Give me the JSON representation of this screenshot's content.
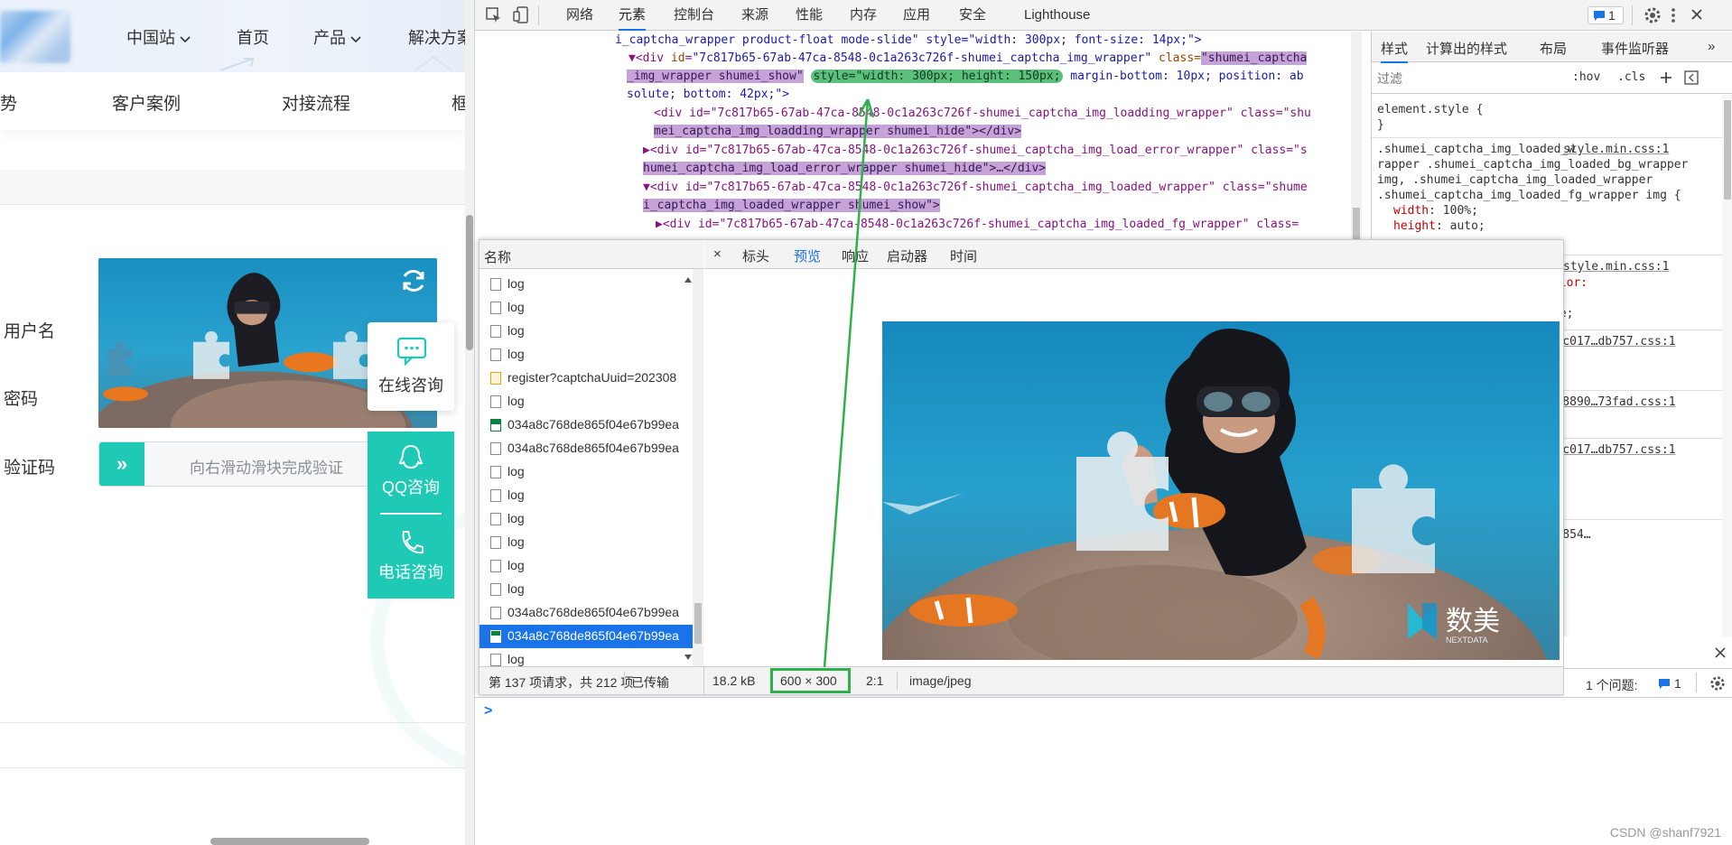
{
  "site": {
    "topnav": [
      {
        "label": "中国站",
        "has_chevron": true
      },
      {
        "label": "首页",
        "has_chevron": false
      },
      {
        "label": "产品",
        "has_chevron": true
      },
      {
        "label": "解决方案",
        "has_chevron": false
      }
    ],
    "subnav": [
      "势",
      "客户案例",
      "对接流程",
      "框"
    ],
    "form": {
      "username_label": "用户名",
      "password_label": "密码",
      "captcha_label": "验证码",
      "slider_text": "向右滑动滑块完成验证",
      "slider_arrow": "»"
    },
    "float": {
      "online": "在线咨询",
      "qq": "QQ咨询",
      "phone": "电话咨询"
    },
    "accent_color": "#1ecab5"
  },
  "devtools": {
    "tabs": [
      "网络",
      "元素",
      "控制台",
      "来源",
      "性能",
      "内存",
      "应用",
      "安全",
      "Lighthouse"
    ],
    "active_tab": "元素",
    "issues_badge": "1",
    "elements": {
      "lines": [
        {
          "text": "i_captcha_wrapper product-float mode-slide\" style=\"width: 300px; font-size: 14px;\">"
        },
        {
          "pre": "▼<div ",
          "id_attr": "id",
          "id_val": "\"7c817b65-67ab-47ca-8548-0c1a263c726f-shumei_captcha_img_wrapper\"",
          "class_attr": " class=",
          "class_val": "\"shumei_captcha"
        },
        {
          "hl_class": "_img_wrapper shumei_show\"",
          "style_hl": "style=\"width: 300px; height: 150px;",
          "rest": " margin-bottom: 10px; position: ab"
        },
        {
          "text": "solute; bottom: 42px;\">"
        },
        {
          "text": "<div id=\"7c817b65-67ab-47ca-8548-0c1a263c726f-shumei_captcha_img_loadding_wrapper\" class=\"shu"
        },
        {
          "text": "mei_captcha_img_loadding_wrapper shumei_hide\"></div>"
        },
        {
          "text": "▶<div id=\"7c817b65-67ab-47ca-8548-0c1a263c726f-shumei_captcha_img_load_error_wrapper\" class=\"s"
        },
        {
          "text": "humei_captcha_img_load_error_wrapper shumei_hide\">…</div>"
        },
        {
          "text": "▼<div id=\"7c817b65-67ab-47ca-8548-0c1a263c726f-shumei_captcha_img_loaded_wrapper\" class=\"shume"
        },
        {
          "text": "i_captcha_img_loaded_wrapper shumei_show\">"
        },
        {
          "text": "▶<div id=\"7c817b65-67ab-47ca-8548-0c1a263c726f-shumei_captcha_img_loaded_fg_wrapper\" class="
        }
      ]
    },
    "styles": {
      "tabs": [
        "样式",
        "计算出的样式",
        "布局",
        "事件监听器",
        "»"
      ],
      "filter_placeholder": "过滤",
      "hov": ":hov",
      "cls": ".cls",
      "element_style": "element.style {",
      "close_brace": "}",
      "rule_selector_1": ".shumei_captcha_img_loaded_w",
      "rule_source_1": "style.min.css:1",
      "rule_selector_2": "rapper .shumei_captcha_img_loaded_bg_wrapper",
      "rule_selector_3": "img, .shumei_captcha_img_loaded_wrapper",
      "rule_selector_4": ".shumei_captcha_img_loaded_fg_wrapper img {",
      "width_prop": "width",
      "width_val": "100%;",
      "height_prop": "height",
      "height_val": "auto;",
      "source_2": "style.min.css:1",
      "olor": "olor:",
      "ne": "ne;",
      "source_3": "d888c017…db757.css:1",
      "source_4": "38098890…73fad.css:1",
      "source_5": "d888c017…db757.css:1",
      "tail": "7ca-854…"
    },
    "network": {
      "name_header": "名称",
      "rows": [
        {
          "name": "log",
          "type": "doc",
          "selected": false
        },
        {
          "name": "log",
          "type": "doc",
          "selected": false
        },
        {
          "name": "log",
          "type": "doc",
          "selected": false
        },
        {
          "name": "log",
          "type": "doc",
          "selected": false
        },
        {
          "name": "register?captchaUuid=202308",
          "type": "js",
          "selected": false
        },
        {
          "name": "log",
          "type": "doc",
          "selected": false
        },
        {
          "name": "034a8c768de865f04e67b99ea",
          "type": "img",
          "selected": false
        },
        {
          "name": "034a8c768de865f04e67b99ea",
          "type": "doc",
          "selected": false
        },
        {
          "name": "log",
          "type": "doc",
          "selected": false
        },
        {
          "name": "log",
          "type": "doc",
          "selected": false
        },
        {
          "name": "log",
          "type": "doc",
          "selected": false
        },
        {
          "name": "log",
          "type": "doc",
          "selected": false
        },
        {
          "name": "log",
          "type": "doc",
          "selected": false
        },
        {
          "name": "log",
          "type": "doc",
          "selected": false
        },
        {
          "name": "034a8c768de865f04e67b99ea",
          "type": "doc",
          "selected": false
        },
        {
          "name": "034a8c768de865f04e67b99ea",
          "type": "img",
          "selected": true
        },
        {
          "name": "log",
          "type": "doc",
          "selected": false
        }
      ],
      "preview_tabs": [
        "×",
        "标头",
        "预览",
        "响应",
        "启动器",
        "时间"
      ],
      "active_preview_tab": "预览",
      "status_requests": "第 137 项请求，共 212 项",
      "status_transferred": "已传输",
      "size": "18.2 kB",
      "dimensions": "600 × 300",
      "ratio": "2:1",
      "mime": "image/jpeg"
    },
    "issues_text": "1 个问题:",
    "issues_count": "1",
    "console_prompt": ">"
  },
  "image_logo_text": "数美",
  "image_logo_sub": "NEXTDATA",
  "watermark": "CSDN @shanf7921",
  "highlight_color": "#2fb04a"
}
